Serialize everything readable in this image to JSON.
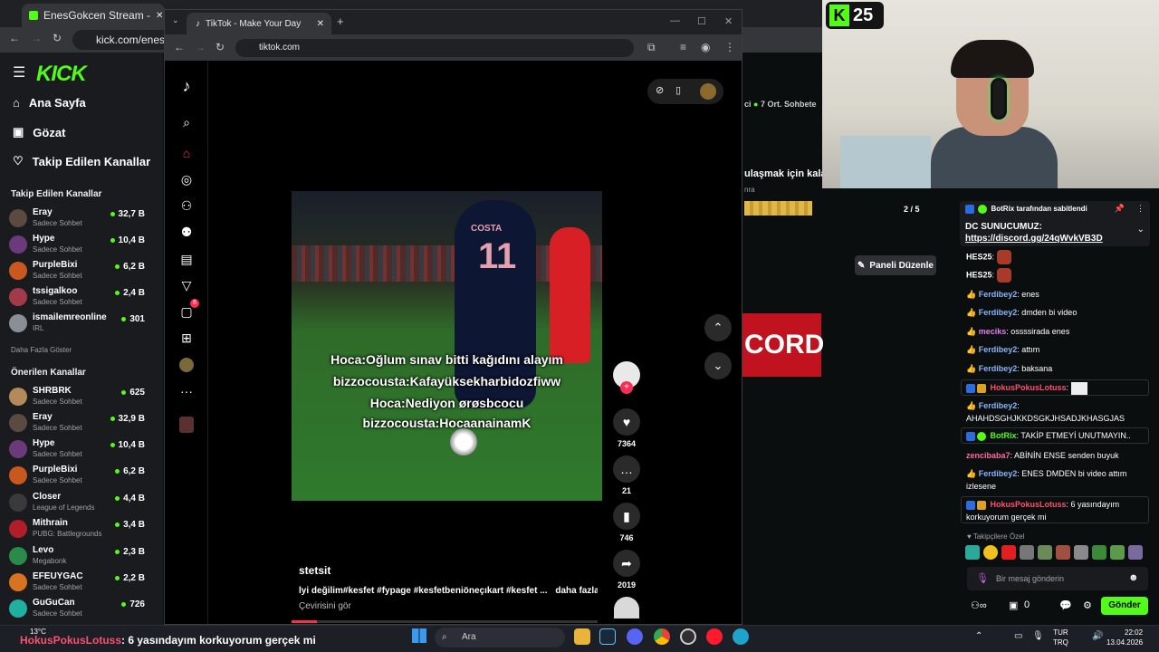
{
  "kick_browser": {
    "tab_title": "EnesGokcen Stream - Watch Li",
    "url": "kick.com/enesgokc",
    "logo": "KICK",
    "nav": [
      {
        "label": "Ana Sayfa",
        "icon": "home-icon"
      },
      {
        "label": "Gözat",
        "icon": "browse-icon"
      },
      {
        "label": "Takip Edilen Kanallar",
        "icon": "heart-icon"
      }
    ],
    "followed_heading": "Takip Edilen Kanallar",
    "followed": [
      {
        "name": "Eray",
        "category": "Sadece Sohbet",
        "viewers": "32,7 B"
      },
      {
        "name": "Hype",
        "category": "Sadece Sohbet",
        "viewers": "10,4 B"
      },
      {
        "name": "PurpleBixi",
        "category": "Sadece Sohbet",
        "viewers": "6,2 B"
      },
      {
        "name": "tssigalkoo",
        "category": "Sadece Sohbet",
        "viewers": "2,4 B"
      },
      {
        "name": "ismailemreonline",
        "category": "IRL",
        "viewers": "301"
      }
    ],
    "show_more": "Daha Fazla Göster",
    "recommended_heading": "Önerilen Kanallar",
    "recommended": [
      {
        "name": "SHRBRK",
        "category": "Sadece Sohbet",
        "viewers": "625"
      },
      {
        "name": "Eray",
        "category": "Sadece Sohbet",
        "viewers": "32,9 B"
      },
      {
        "name": "Hype",
        "category": "Sadece Sohbet",
        "viewers": "10,4 B"
      },
      {
        "name": "PurpleBixi",
        "category": "Sadece Sohbet",
        "viewers": "6,2 B"
      },
      {
        "name": "Closer",
        "category": "League of Legends",
        "viewers": "4,4 B"
      },
      {
        "name": "Mithrain",
        "category": "PUBG: Battlegrounds",
        "viewers": "3,4 B"
      },
      {
        "name": "Levo",
        "category": "Megabonk",
        "viewers": "2,3 B"
      },
      {
        "name": "EFEUYGAC",
        "category": "Sadece Sohbet",
        "viewers": "2,2 B"
      },
      {
        "name": "GuGuCan",
        "category": "Sadece Sohbet",
        "viewers": "726"
      }
    ],
    "mid": {
      "avg_chat": "7 Ort. Sohbete",
      "reach_text": "ulaşmak için kala",
      "reach_sub": "nra",
      "page_counter": "2 / 5",
      "edit_panel": "Paneli Düzenle",
      "banner_text": "CORD"
    }
  },
  "tiktok": {
    "tab_title": "TikTok - Make Your Day",
    "url": "tiktok.com",
    "captions": [
      "Hoca:Oğlum sınav bitti kağıdını alayım",
      "bizzocousta:Kafayüksekharbidozfiww",
      "Hoca:Nediyon ørøsbcocu",
      "bizzocousta:HocaanainamK"
    ],
    "jersey_name": "COSTA",
    "jersey_number": "11",
    "likes": "7364",
    "comments": "21",
    "saves": "746",
    "shares": "2019",
    "author": "stetsit",
    "description": "İyi değilim#kesfet #fypage #kesfetbeniöneçıkart #kesfet ...",
    "more_label": "daha fazlası",
    "translate_label": "Çevirisini gör",
    "inbox_badge": "6"
  },
  "webcam": {
    "kick_badge_number": "25"
  },
  "chat": {
    "pinned_by": "BotRix tarafından sabitlendi",
    "pinned_line1": "DC SUNUCUMUZ:",
    "pinned_link": "https://discord.gg/24qWvkVB3D",
    "messages": [
      {
        "user": "HES25",
        "text": "",
        "color": "#ffffff",
        "emote": true
      },
      {
        "user": "HES25",
        "text": "",
        "color": "#ffffff",
        "emote": true
      },
      {
        "user": "Ferdibey2",
        "text": "enes",
        "color": "#8ab4f8"
      },
      {
        "user": "Ferdibey2",
        "text": "dmden bi video",
        "color": "#8ab4f8"
      },
      {
        "user": "meciks",
        "text": "ossssirada enes",
        "color": "#e57cf0"
      },
      {
        "user": "Ferdibey2",
        "text": "attım",
        "color": "#8ab4f8"
      },
      {
        "user": "Ferdibey2",
        "text": "baksana",
        "color": "#8ab4f8"
      },
      {
        "user": "HokusPokusLotuss",
        "text": "",
        "color": "#ff4f6e",
        "boxed": true
      },
      {
        "user": "Ferdibey2",
        "text": "AHAHDSGHJKKDSGKJHSADJKHASGJAS",
        "color": "#8ab4f8"
      },
      {
        "user": "BotRix",
        "text": "TAKİP ETMEYİ UNUTMAYIN..",
        "color": "#53fc18",
        "boxed": true
      },
      {
        "user": "zencibaba7",
        "text": "ABİNİN ENSE senden buyuk",
        "color": "#ff6b9b"
      },
      {
        "user": "Ferdibey2",
        "text": "ENES DMDEN bi video attım izlesene",
        "color": "#8ab4f8"
      },
      {
        "user": "HokusPokusLotuss",
        "text": "6 yasındayım korkuyorum gerçek mi",
        "color": "#ff4f6e",
        "boxed": true
      }
    ],
    "followers_only": "Takipçilere Özel",
    "input_placeholder": "Bir mesaj gönderin",
    "points": "0",
    "send_label": "Gönder"
  },
  "taskbar": {
    "weather": "13°C",
    "overlay_user": "HokusPokusLotuss",
    "overlay_text": ": 6 yasındayım korkuyorum gerçek mi",
    "search_placeholder": "Ara",
    "lang_line1": "TUR",
    "lang_line2": "TRQ",
    "time": "22:02",
    "date": "13.04.2026"
  },
  "colors": {
    "kick_green": "#53fc18",
    "tiktok_red": "#fe2c55"
  }
}
